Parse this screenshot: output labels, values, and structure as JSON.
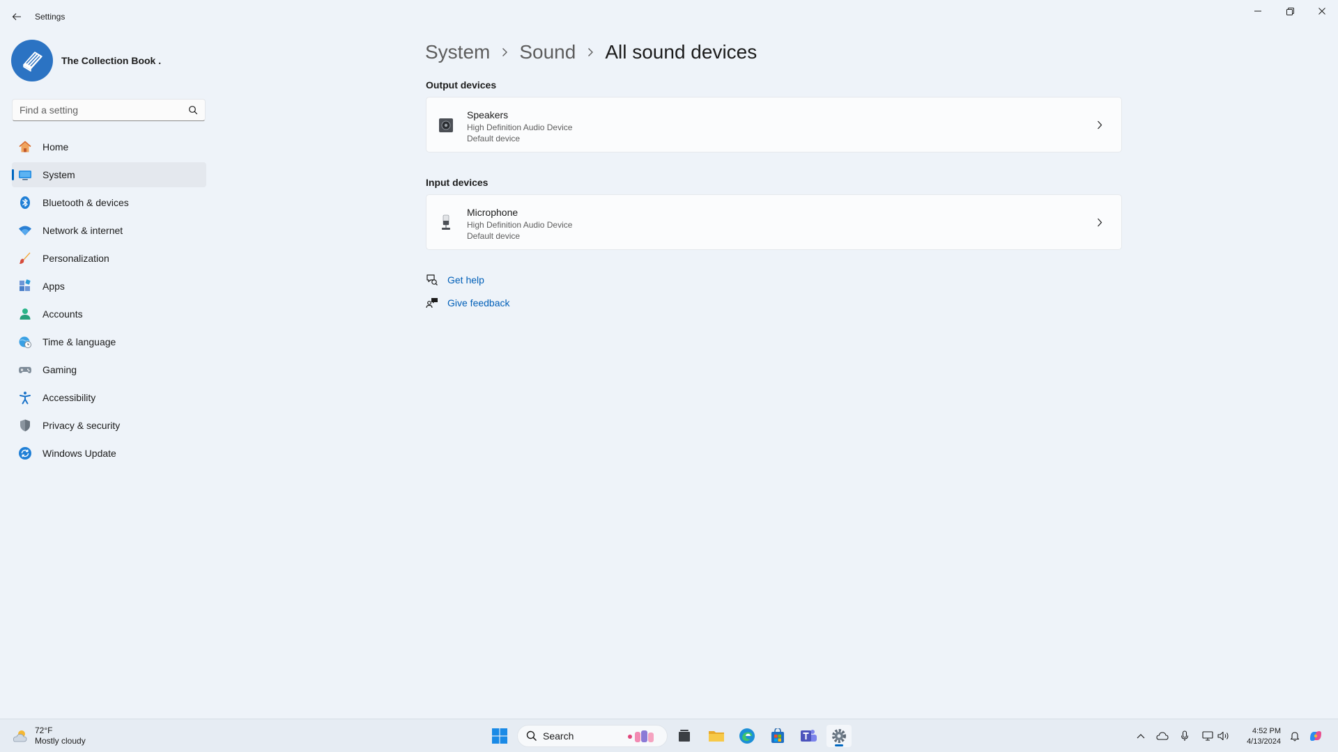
{
  "window": {
    "app_title": "Settings"
  },
  "profile": {
    "name": "The Collection Book ."
  },
  "search": {
    "placeholder": "Find a setting"
  },
  "sidebar": {
    "items": [
      {
        "label": "Home",
        "icon": "home-icon"
      },
      {
        "label": "System",
        "icon": "system-icon",
        "selected": true
      },
      {
        "label": "Bluetooth & devices",
        "icon": "bluetooth-icon"
      },
      {
        "label": "Network & internet",
        "icon": "wifi-icon"
      },
      {
        "label": "Personalization",
        "icon": "brush-icon"
      },
      {
        "label": "Apps",
        "icon": "apps-icon"
      },
      {
        "label": "Accounts",
        "icon": "accounts-icon"
      },
      {
        "label": "Time & language",
        "icon": "globe-clock-icon"
      },
      {
        "label": "Gaming",
        "icon": "gamepad-icon"
      },
      {
        "label": "Accessibility",
        "icon": "accessibility-icon"
      },
      {
        "label": "Privacy & security",
        "icon": "shield-icon"
      },
      {
        "label": "Windows Update",
        "icon": "update-icon"
      }
    ]
  },
  "breadcrumb": {
    "items": [
      "System",
      "Sound"
    ],
    "current": "All sound devices"
  },
  "output": {
    "title": "Output devices",
    "device": {
      "name": "Speakers",
      "driver": "High Definition Audio Device",
      "status": "Default device",
      "icon": "speaker-icon"
    }
  },
  "input": {
    "title": "Input devices",
    "device": {
      "name": "Microphone",
      "driver": "High Definition Audio Device",
      "status": "Default device",
      "icon": "microphone-icon"
    }
  },
  "help": {
    "get_help": "Get help",
    "give_feedback": "Give feedback"
  },
  "taskbar": {
    "weather": {
      "temp": "72°F",
      "condition": "Mostly cloudy"
    },
    "search_label": "Search",
    "clock": {
      "time": "4:52 PM",
      "date": "4/13/2024"
    }
  },
  "colors": {
    "accent": "#0067c0",
    "link": "#005fb8",
    "background": "#eef3f9"
  }
}
